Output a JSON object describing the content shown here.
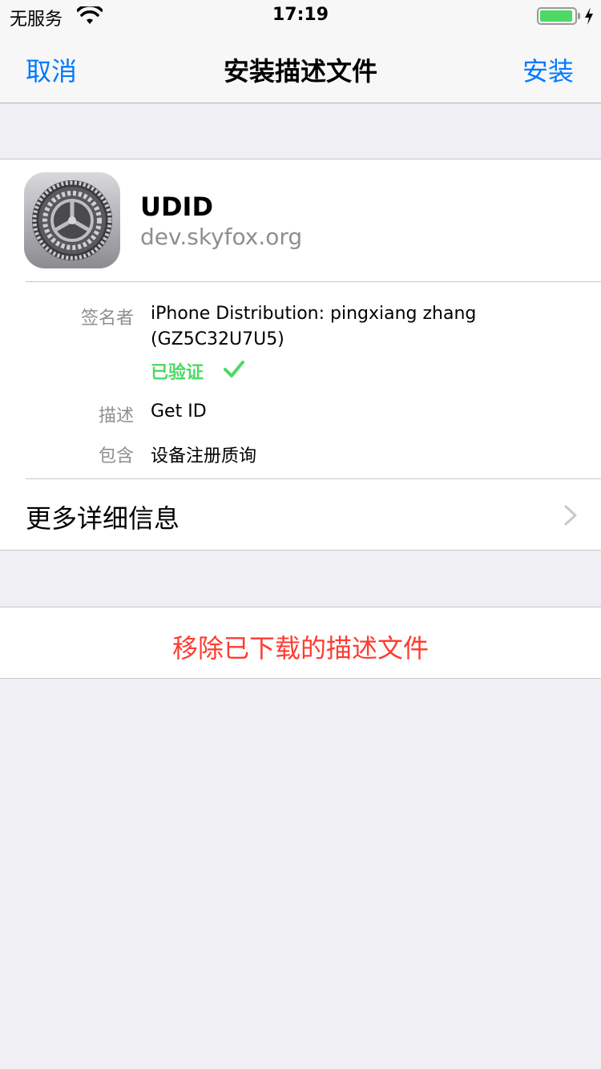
{
  "status_bar": {
    "carrier": "无服务",
    "time": "17:19",
    "battery_level": 0.95,
    "charging": true,
    "battery_color": "#4cd964"
  },
  "nav": {
    "cancel_label": "取消",
    "title": "安装描述文件",
    "install_label": "安装",
    "accent_color": "#007aff"
  },
  "profile": {
    "icon": "settings-gear-icon",
    "name": "UDID",
    "domain": "dev.skyfox.org"
  },
  "details": {
    "signer_label": "签名者",
    "signer_line1": "iPhone Distribution: pingxiang zhang",
    "signer_line2": "(GZ5C32U7U5)",
    "verified_label": "已验证",
    "verified_icon": "checkmark-icon",
    "description_label": "描述",
    "description_value": "Get ID",
    "contains_label": "包含",
    "contains_value": "设备注册质询"
  },
  "more_info": {
    "label": "更多详细信息",
    "icon": "chevron-right-icon"
  },
  "remove": {
    "label": "移除已下载的描述文件",
    "color": "#ff3b30"
  }
}
